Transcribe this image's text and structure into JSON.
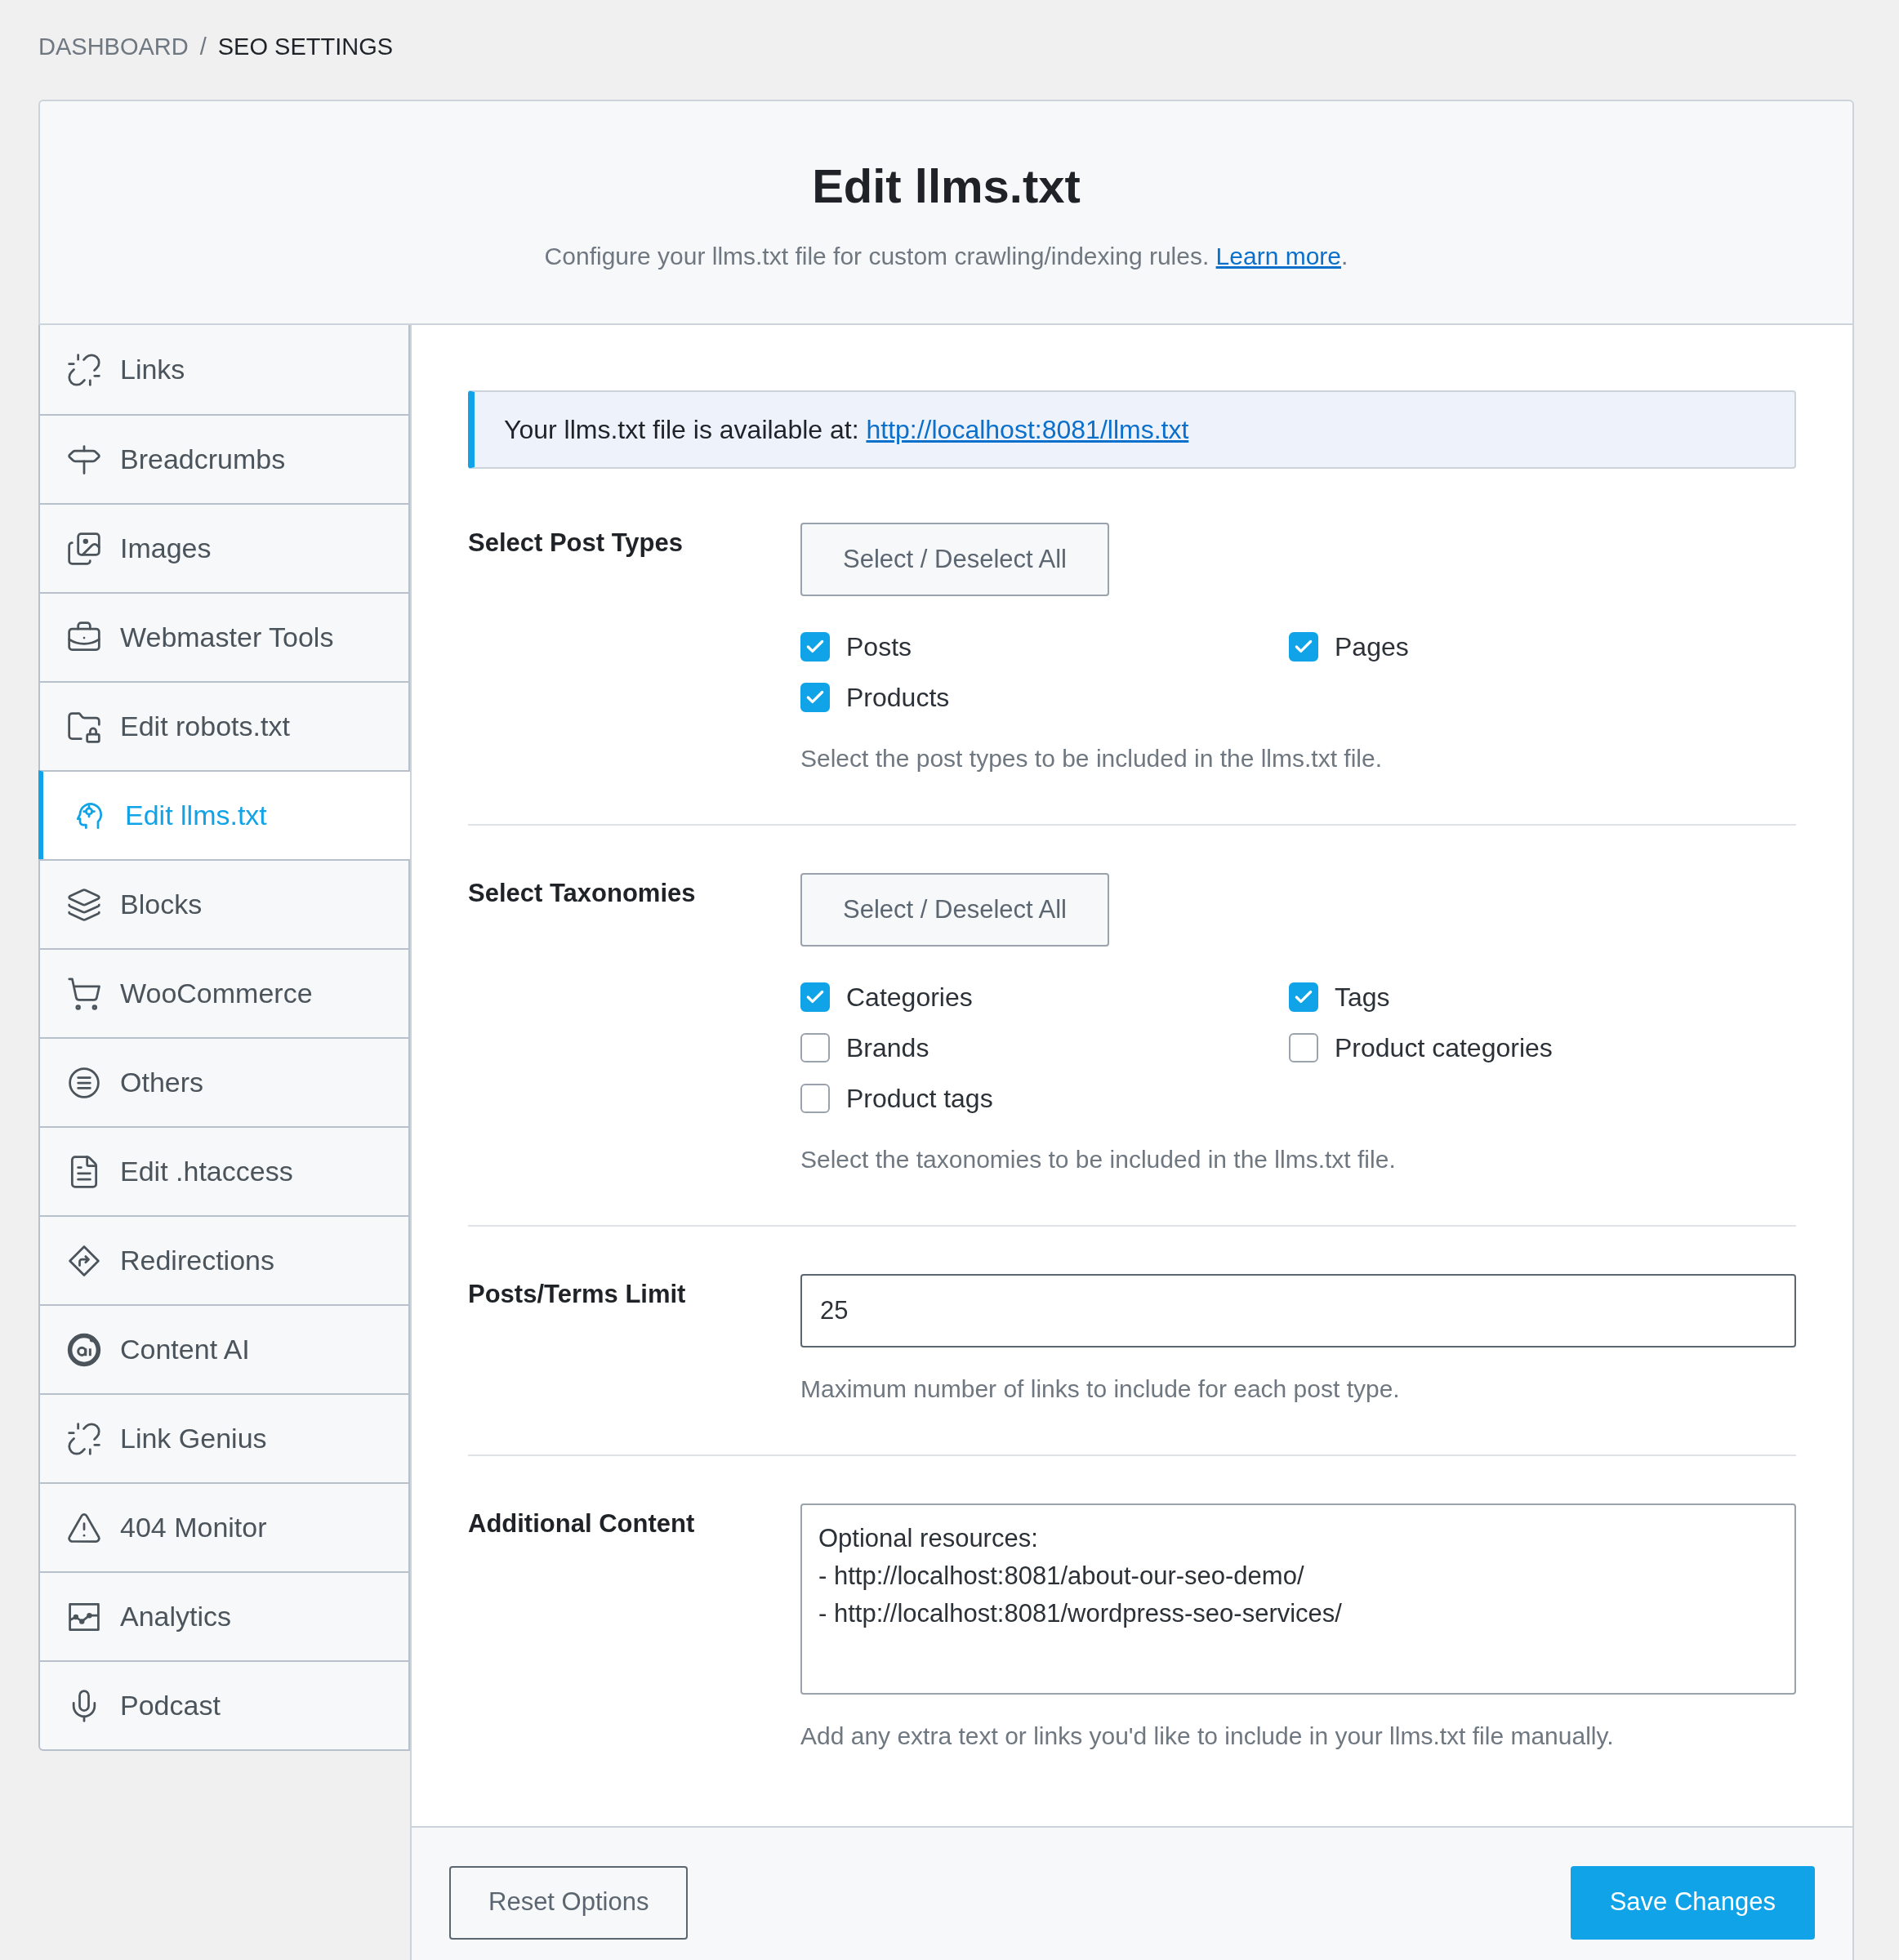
{
  "breadcrumb": [
    {
      "label": "DASHBOARD",
      "kind": "link"
    },
    {
      "label": "/",
      "kind": "separator"
    },
    {
      "label": "SEO SETTINGS",
      "kind": "current"
    }
  ],
  "header": {
    "title": "Edit llms.txt",
    "description": "Configure your llms.txt file for custom crawling/indexing rules.",
    "link": "Learn more",
    "suffix": "."
  },
  "sidebar": {
    "items": [
      {
        "label": "Links",
        "selected": false
      },
      {
        "label": "Breadcrumbs",
        "selected": false
      },
      {
        "label": "Images",
        "selected": false
      },
      {
        "label": "Webmaster Tools",
        "selected": false
      },
      {
        "label": "Edit robots.txt",
        "selected": false
      },
      {
        "label": "Edit llms.txt",
        "selected": true
      },
      {
        "label": "Blocks",
        "selected": false
      },
      {
        "label": "WooCommerce",
        "selected": false
      },
      {
        "label": "Others",
        "selected": false
      },
      {
        "label": "Edit .htaccess",
        "selected": false
      },
      {
        "label": "Redirections",
        "selected": false
      },
      {
        "label": "Content AI",
        "selected": false
      },
      {
        "label": "Link Genius",
        "selected": false
      },
      {
        "label": "404 Monitor",
        "selected": false
      },
      {
        "label": "Analytics",
        "selected": false
      },
      {
        "label": "Podcast",
        "selected": false
      }
    ]
  },
  "notice": {
    "text": "Your llms.txt file is available at:",
    "link": "http://localhost:8081/llms.txt"
  },
  "sections": [
    {
      "kind": "checkboxes",
      "label": "Select Post Types",
      "button": "Select / Deselect All",
      "options": [
        {
          "label": "Posts",
          "checked": true
        },
        {
          "label": "Pages",
          "checked": true
        },
        {
          "label": "Products",
          "checked": true
        }
      ],
      "help": "Select the post types to be included in the llms.txt file."
    },
    {
      "kind": "checkboxes",
      "label": "Select Taxonomies",
      "button": "Select / Deselect All",
      "options": [
        {
          "label": "Categories",
          "checked": true
        },
        {
          "label": "Tags",
          "checked": true
        },
        {
          "label": "Brands",
          "checked": false
        },
        {
          "label": "Product categories",
          "checked": false
        },
        {
          "label": "Product tags",
          "checked": false
        }
      ],
      "help": "Select the taxonomies to be included in the llms.txt file."
    },
    {
      "kind": "number",
      "label": "Posts/Terms Limit",
      "value": "25",
      "help": "Maximum number of links to include for each post type."
    },
    {
      "kind": "textarea",
      "label": "Additional Content",
      "value": "Optional resources:\n- http://localhost:8081/about-our-seo-demo/\n- http://localhost:8081/wordpress-seo-services/",
      "help": "Add any extra text or links you'd like to include in your llms.txt file manually."
    }
  ],
  "footer": {
    "reset": "Reset Options",
    "save": "Save Changes"
  }
}
